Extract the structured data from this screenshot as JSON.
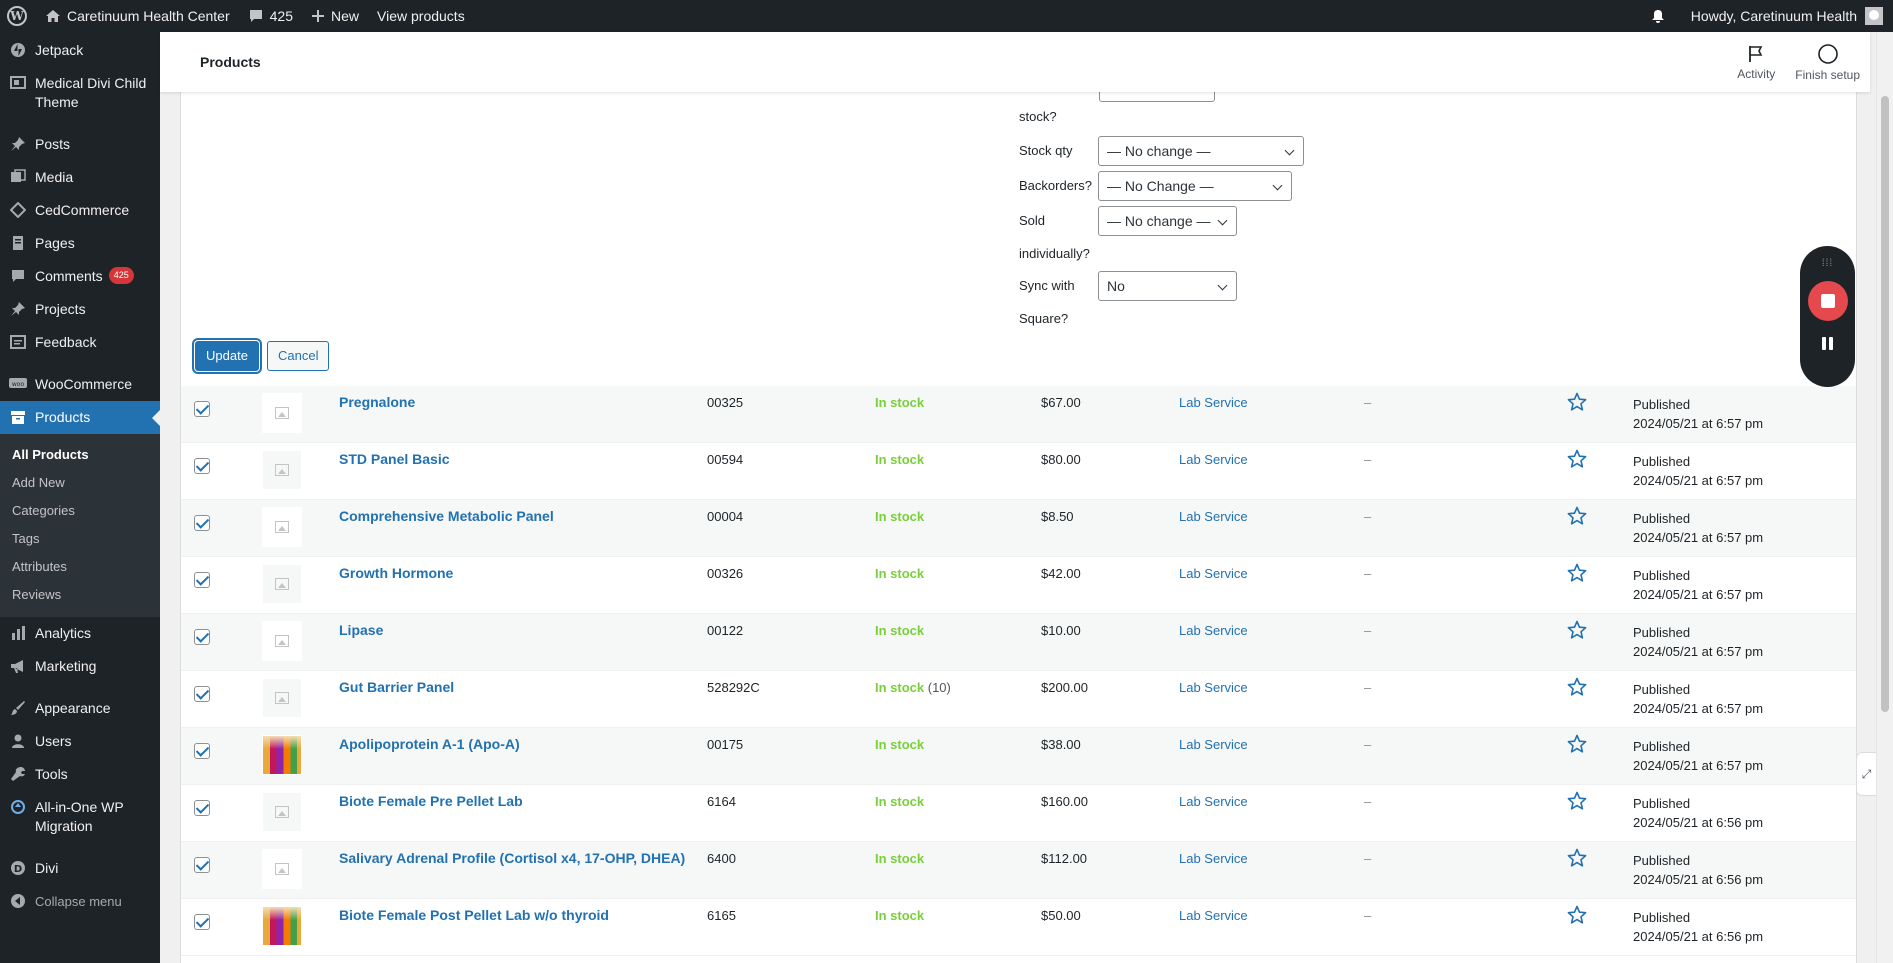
{
  "admin_bar": {
    "site_name": "Caretinuum Health Center",
    "comments_count": "425",
    "new_label": "New",
    "view_label": "View products",
    "howdy": "Howdy, Caretinuum Health"
  },
  "sidebar": {
    "items": [
      {
        "label": "Jetpack",
        "icon": "jetpack-icon"
      },
      {
        "label": "Medical Divi Child Theme",
        "icon": "theme-icon"
      },
      {
        "label": "Posts",
        "icon": "pin-icon"
      },
      {
        "label": "Media",
        "icon": "media-icon"
      },
      {
        "label": "CedCommerce",
        "icon": "cedcommerce-icon"
      },
      {
        "label": "Pages",
        "icon": "page-icon"
      },
      {
        "label": "Comments",
        "icon": "comment-icon",
        "badge": "425"
      },
      {
        "label": "Projects",
        "icon": "pin-icon"
      },
      {
        "label": "Feedback",
        "icon": "feedback-icon"
      },
      {
        "label": "WooCommerce",
        "icon": "woo-icon"
      },
      {
        "label": "Products",
        "icon": "archive-icon"
      },
      {
        "label": "Analytics",
        "icon": "bar-chart-icon"
      },
      {
        "label": "Marketing",
        "icon": "megaphone-icon"
      },
      {
        "label": "Appearance",
        "icon": "paintbrush-icon"
      },
      {
        "label": "Users",
        "icon": "user-icon"
      },
      {
        "label": "Tools",
        "icon": "wrench-icon"
      },
      {
        "label": "All-in-One WP Migration",
        "icon": "migration-icon"
      },
      {
        "label": "Divi",
        "icon": "divi-icon"
      },
      {
        "label": "Collapse menu",
        "icon": "collapse-icon"
      }
    ],
    "submenu": [
      "All Products",
      "Add New",
      "Categories",
      "Tags",
      "Attributes",
      "Reviews"
    ]
  },
  "header": {
    "title": "Products",
    "activity": "Activity",
    "finish_setup": "Finish setup"
  },
  "bulk_edit": {
    "in_stock_tail": "stock?",
    "stock_qty_label": "Stock qty",
    "stock_qty_value": "— No change —",
    "backorders_label": "Backorders?",
    "backorders_value": "— No Change —",
    "sold_label_1": "Sold",
    "sold_label_2": "individually?",
    "sold_value": "— No change —",
    "sync_label_1": "Sync with",
    "sync_label_2": "Square?",
    "sync_value": "No",
    "update_label": "Update",
    "cancel_label": "Cancel"
  },
  "products": [
    {
      "name": "Pregnalone",
      "sku": "00325",
      "stock": "In stock",
      "qty": "",
      "price": "$67.00",
      "category": "Lab Service",
      "tag": "–",
      "status": "Published",
      "date": "2024/05/21 at 6:57 pm",
      "thumb": "placeholder"
    },
    {
      "name": "STD Panel Basic",
      "sku": "00594",
      "stock": "In stock",
      "qty": "",
      "price": "$80.00",
      "category": "Lab Service",
      "tag": "–",
      "status": "Published",
      "date": "2024/05/21 at 6:57 pm",
      "thumb": "placeholder"
    },
    {
      "name": "Comprehensive Metabolic Panel",
      "sku": "00004",
      "stock": "In stock",
      "qty": "",
      "price": "$8.50",
      "category": "Lab Service",
      "tag": "–",
      "status": "Published",
      "date": "2024/05/21 at 6:57 pm",
      "thumb": "placeholder"
    },
    {
      "name": "Growth Hormone",
      "sku": "00326",
      "stock": "In stock",
      "qty": "",
      "price": "$42.00",
      "category": "Lab Service",
      "tag": "–",
      "status": "Published",
      "date": "2024/05/21 at 6:57 pm",
      "thumb": "placeholder"
    },
    {
      "name": "Lipase",
      "sku": "00122",
      "stock": "In stock",
      "qty": "",
      "price": "$10.00",
      "category": "Lab Service",
      "tag": "–",
      "status": "Published",
      "date": "2024/05/21 at 6:57 pm",
      "thumb": "placeholder"
    },
    {
      "name": "Gut Barrier Panel",
      "sku": "528292C",
      "stock": "In stock",
      "qty": "(10)",
      "price": "$200.00",
      "category": "Lab Service",
      "tag": "–",
      "status": "Published",
      "date": "2024/05/21 at 6:57 pm",
      "thumb": "placeholder"
    },
    {
      "name": "Apolipoprotein A-1 (Apo-A)",
      "sku": "00175",
      "stock": "In stock",
      "qty": "",
      "price": "$38.00",
      "category": "Lab Service",
      "tag": "–",
      "status": "Published",
      "date": "2024/05/21 at 6:57 pm",
      "thumb": "photo"
    },
    {
      "name": "Biote Female Pre Pellet Lab",
      "sku": "6164",
      "stock": "In stock",
      "qty": "",
      "price": "$160.00",
      "category": "Lab Service",
      "tag": "–",
      "status": "Published",
      "date": "2024/05/21 at 6:56 pm",
      "thumb": "placeholder"
    },
    {
      "name": "Salivary Adrenal Profile (Cortisol x4, 17-OHP, DHEA)",
      "sku": "6400",
      "stock": "In stock",
      "qty": "",
      "price": "$112.00",
      "category": "Lab Service",
      "tag": "–",
      "status": "Published",
      "date": "2024/05/21 at 6:56 pm",
      "thumb": "placeholder"
    },
    {
      "name": "Biote Female Post Pellet Lab w/o thyroid",
      "sku": "6165",
      "stock": "In stock",
      "qty": "",
      "price": "$50.00",
      "category": "Lab Service",
      "tag": "–",
      "status": "Published",
      "date": "2024/05/21 at 6:56 pm",
      "thumb": "photo"
    }
  ],
  "colors": {
    "admin_dark": "#1d2327",
    "accent": "#2271b1",
    "in_stock": "#7ad03a",
    "badge": "#d63638",
    "record": "#e5484d"
  }
}
